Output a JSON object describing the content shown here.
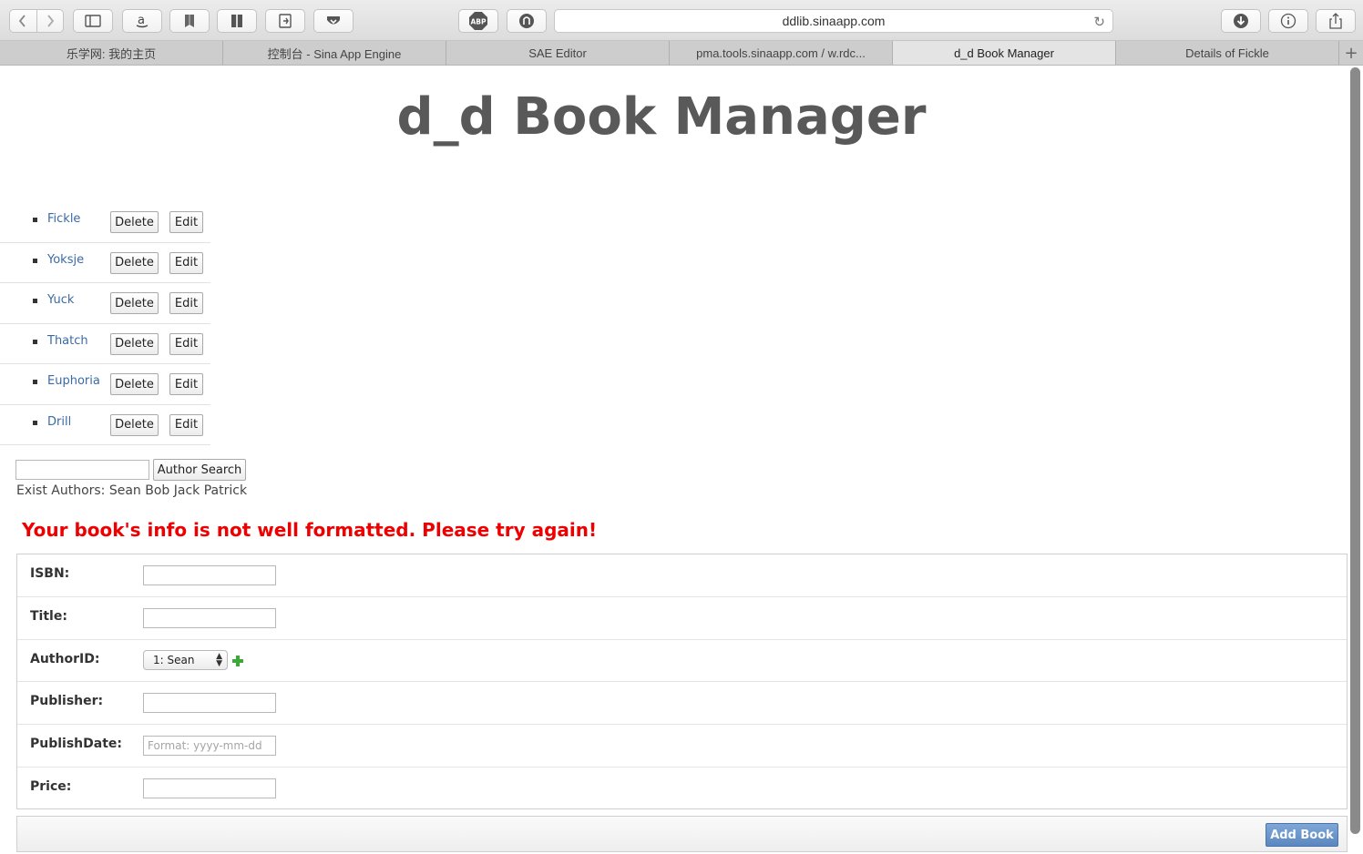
{
  "browser": {
    "url": "ddlib.sinaapp.com",
    "tabs": [
      {
        "label": "乐学网: 我的主页",
        "active": false
      },
      {
        "label": "控制台 - Sina App Engine",
        "active": false
      },
      {
        "label": "SAE Editor",
        "active": false
      },
      {
        "label": "pma.tools.sinaapp.com / w.rdc...",
        "active": false
      },
      {
        "label": "d_d Book Manager",
        "active": true
      },
      {
        "label": "Details of Fickle",
        "active": false
      }
    ],
    "new_tab_label": "+",
    "toolbar_icons": [
      "back-icon",
      "forward-icon",
      "sidebar-icon",
      "amazon-icon",
      "bookmark-icon",
      "reader-icon",
      "share-extension-icon",
      "pocket-icon",
      "adblock-icon",
      "ghostery-icon",
      "reload-icon",
      "downloads-icon",
      "info-icon",
      "share-icon"
    ],
    "adblock_label": "ABP"
  },
  "page": {
    "title": "d_d Book Manager",
    "books": [
      {
        "title": "Fickle",
        "delete_label": "Delete",
        "edit_label": "Edit"
      },
      {
        "title": "Yoksje",
        "delete_label": "Delete",
        "edit_label": "Edit"
      },
      {
        "title": "Yuck",
        "delete_label": "Delete",
        "edit_label": "Edit"
      },
      {
        "title": "Thatch",
        "delete_label": "Delete",
        "edit_label": "Edit"
      },
      {
        "title": "Euphoria",
        "delete_label": "Delete",
        "edit_label": "Edit"
      },
      {
        "title": "Drill",
        "delete_label": "Delete",
        "edit_label": "Edit"
      }
    ],
    "author_search": {
      "value": "",
      "button_label": "Author Search",
      "exist_authors": "Exist Authors: Sean Bob Jack Patrick"
    },
    "error_message": "Your book's info is not well formatted. Please try again!",
    "form": {
      "isbn_label": "ISBN:",
      "isbn_value": "",
      "title_label": "Title:",
      "title_value": "",
      "author_label": "AuthorID:",
      "author_selected": "1: Sean",
      "publisher_label": "Publisher:",
      "publisher_value": "",
      "publish_date_label": "PublishDate:",
      "publish_date_placeholder": "Format: yyyy-mm-dd",
      "price_label": "Price:",
      "price_value": "",
      "submit_label": "Add Book"
    },
    "colors": {
      "link": "#3a6aa6",
      "error": "#ee0000",
      "title": "#595959",
      "submit_button": "#5a87c0",
      "add_icon": "#3aa935"
    }
  }
}
